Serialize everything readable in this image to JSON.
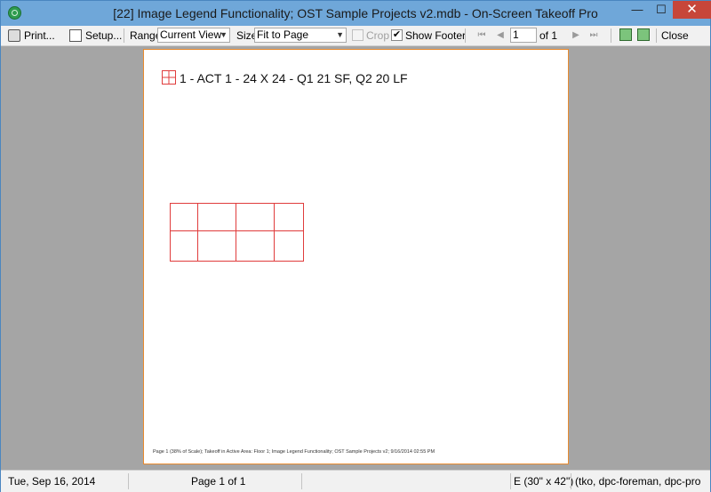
{
  "window": {
    "title": "[22] Image Legend Functionality; OST Sample Projects v2.mdb - On-Screen Takeoff Pro",
    "minimize_glyph": "—",
    "maximize_glyph": "☐",
    "close_glyph": "✕"
  },
  "toolbar": {
    "print_label": "Print...",
    "setup_label": "Setup...",
    "range_label": "Range",
    "range_value": "Current View",
    "size_label": "Size",
    "size_value": "Fit to Page",
    "crop_label": "Crop",
    "crop_checked": false,
    "show_footer_label": "Show Footer",
    "show_footer_checked": true,
    "check_mark": "✔",
    "page_number": "1",
    "page_of": "of 1",
    "nav_first": "⏮",
    "nav_prev": "◀",
    "nav_next": "▶",
    "nav_last": "⏭",
    "close_label": "Close"
  },
  "page": {
    "legend_text": "1 - ACT 1 - 24 X 24 - Q1 21 SF, Q2 20 LF",
    "footer_text": "Page 1 (38% of Scale); Takeoff in Active Area: Floor 1; Image Legend Functionality; OST Sample Projects v2; 9/16/2014 02:55 PM"
  },
  "status": {
    "date": "Tue, Sep 16, 2014",
    "page": "Page 1 of 1",
    "paper": "E (30\" x 42\")",
    "users": "(tko, dpc-foreman, dpc-pro"
  },
  "colors": {
    "title_bar": "#6fa7d9",
    "close_button": "#c7463a",
    "canvas": "#a5a5a5",
    "page_border": "#e88a2e",
    "takeoff_red": "#e03c3c"
  }
}
